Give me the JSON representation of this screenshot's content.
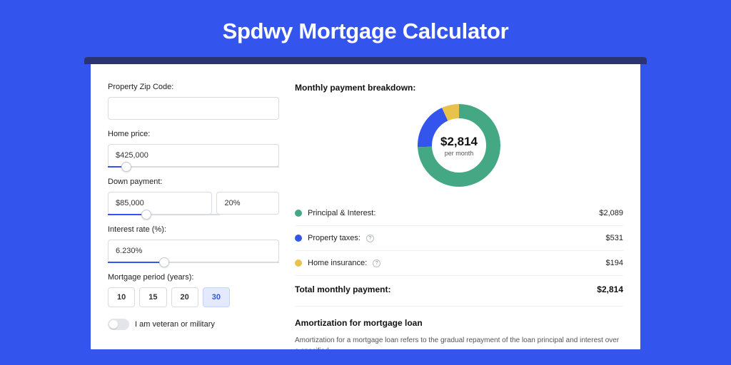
{
  "header": {
    "title": "Spdwy Mortgage Calculator"
  },
  "form": {
    "zip": {
      "label": "Property Zip Code:",
      "value": ""
    },
    "home_price": {
      "label": "Home price:",
      "value": "$425,000",
      "slider_pct": 8
    },
    "down_payment": {
      "label": "Down payment:",
      "amount": "$85,000",
      "percent": "20%",
      "slider_pct": 20
    },
    "interest_rate": {
      "label": "Interest rate (%):",
      "value": "6.230%",
      "slider_pct": 30
    },
    "period": {
      "label": "Mortgage period (years):",
      "options": [
        "10",
        "15",
        "20",
        "30"
      ],
      "selected": "30"
    },
    "veteran": {
      "label": "I am veteran or military",
      "checked": false
    }
  },
  "breakdown": {
    "title": "Monthly payment breakdown:",
    "center_amount": "$2,814",
    "center_sub": "per month",
    "rows": [
      {
        "color": "g",
        "label": "Principal & Interest:",
        "value": "$2,089",
        "info": false
      },
      {
        "color": "b",
        "label": "Property taxes:",
        "value": "$531",
        "info": true
      },
      {
        "color": "y",
        "label": "Home insurance:",
        "value": "$194",
        "info": true
      }
    ],
    "total_label": "Total monthly payment:",
    "total_value": "$2,814"
  },
  "amortization": {
    "title": "Amortization for mortgage loan",
    "text": "Amortization for a mortgage loan refers to the gradual repayment of the loan principal and interest over a specified"
  },
  "chart_data": {
    "type": "pie",
    "title": "Monthly payment breakdown",
    "series": [
      {
        "name": "Principal & Interest",
        "value": 2089,
        "color": "#45a884"
      },
      {
        "name": "Property taxes",
        "value": 531,
        "color": "#3355ee"
      },
      {
        "name": "Home insurance",
        "value": 194,
        "color": "#e8c24a"
      }
    ],
    "total": 2814,
    "unit": "USD per month"
  }
}
